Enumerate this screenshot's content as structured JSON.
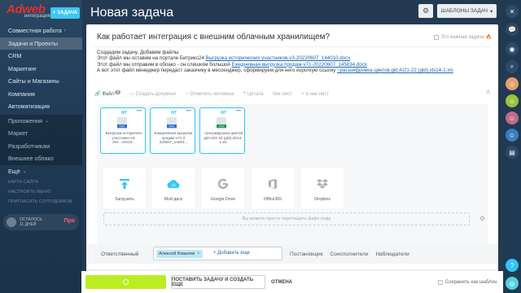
{
  "sidebar": {
    "logo": "Adweb",
    "logo_sub": "интеграция",
    "add_task_label": "ЗАДАЧА",
    "items": [
      {
        "label": "Совместная работа",
        "chev": "›"
      },
      {
        "label": "Задачи и Проекты"
      },
      {
        "label": "CRM"
      },
      {
        "label": "Маркетинг"
      },
      {
        "label": "Сайты и Магазины"
      },
      {
        "label": "Компания"
      },
      {
        "label": "Автоматизация"
      }
    ],
    "group": [
      {
        "label": "Приложения",
        "chev": "⌄"
      },
      {
        "label": "Маркет"
      },
      {
        "label": "Разработчикам"
      },
      {
        "label": "Внешнее облако"
      },
      {
        "label": "Ещё",
        "chev": "⌄"
      }
    ],
    "small": [
      "КАРТА САЙТА",
      "НАСТРОИТЬ МЕНЮ",
      "ПРИГЛАСИТЬ СОТРУДНИКОВ"
    ],
    "trial_line1": "ОСТАЛОСЬ",
    "trial_line2": "11 ДНЕЙ",
    "trial_plan": "Про"
  },
  "header": {
    "title": "Новая задача",
    "templates_label": "ШАБЛОНЫ ЗАДАЧ"
  },
  "task": {
    "question": "Как работает интеграция с внешним облачным хранилищем?",
    "important_label": "Это важная задача",
    "desc": {
      "line1": "Создадим задачу. Добавим файлы.",
      "line2_text": "Этот файл мы оставим на портале Битрикс24",
      "line2_link": "Выгрузка исторических участников-v3-20220607_144010.docx",
      "line3_text": "Этот файл мы отправим в облако - он слишком большой",
      "line3_link": "Ежедневная выгрузка продаж-v71-20220607_145834.docx",
      "line4_text": "А вот этот файл менеджер передаст заказчику в мессенджер, сформируем для него короткую ссылку",
      "line4_link": "~расшифровка цветов gld AI21-22 (gld).xls14-1.xls"
    }
  },
  "toolbar": {
    "file": "Файл",
    "file_count": "3",
    "create_doc": "Создать документ",
    "mark_person": "Отметить человека",
    "quote": "Цитата",
    "checklist": "Чек-лист",
    "in_checklist": "в чек-лист"
  },
  "files": [
    {
      "tag": "ФТ",
      "type": "DOC",
      "type_color": "#2b6ed1",
      "name": "Выгрузка историческ участнико-v3-202...44010..."
    },
    {
      "tag": "ФТ",
      "type": "DOC",
      "type_color": "#2b6ed1",
      "name": "Ежедневная выгрузка продаж-v71-2 220607_14583..."
    },
    {
      "tag": "ФТ",
      "type": "XLS",
      "type_color": "#1d9a4c",
      "name": "~расшифровка цветов gld AI21-22 (gld).xls14-1.xls"
    }
  ],
  "sources": [
    {
      "label": "Загрузить",
      "icon": "upload-icon"
    },
    {
      "label": "Мой диск",
      "icon": "my-drive-icon"
    },
    {
      "label": "Google Drive",
      "icon": "google-drive-icon"
    },
    {
      "label": "Office365",
      "icon": "office365-icon"
    },
    {
      "label": "Dropbox",
      "icon": "dropbox-icon"
    }
  ],
  "dropzone_text": "Вы можете просто перетащить файл сюда",
  "responsible": {
    "label": "Ответственный",
    "person": "Алексей Ковалев",
    "add_more": "+ Добавить еще",
    "roles": [
      "Постановщик",
      "Соисполнители",
      "Наблюдатели"
    ]
  },
  "footer": {
    "create_and_more": "ПОСТАВИТЬ ЗАДАЧУ И СОЗДАТЬ ЕЩЕ",
    "cancel": "ОТМЕНА",
    "save_template": "Сохранить как шаблон"
  },
  "colors": {
    "accent_blue": "#2fc6f6",
    "green": "#bbed21",
    "header_bg": "#233a52"
  }
}
